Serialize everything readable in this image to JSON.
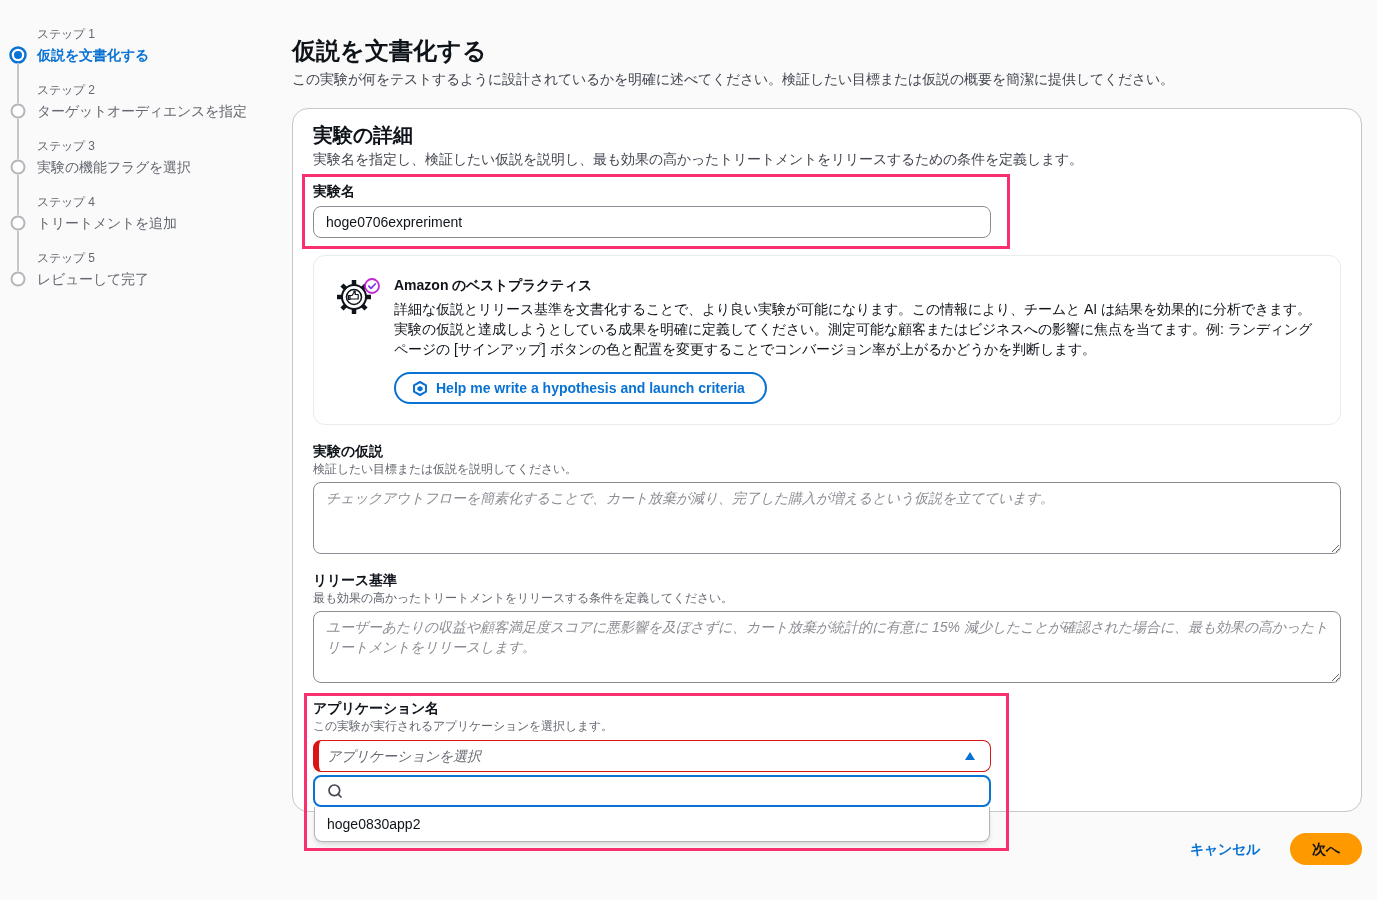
{
  "steps": [
    {
      "label": "ステップ 1",
      "title": "仮説を文書化する",
      "selected": true
    },
    {
      "label": "ステップ 2",
      "title": "ターゲットオーディエンスを指定",
      "selected": false
    },
    {
      "label": "ステップ 3",
      "title": "実験の機能フラグを選択",
      "selected": false
    },
    {
      "label": "ステップ 4",
      "title": "トリートメントを追加",
      "selected": false
    },
    {
      "label": "ステップ 5",
      "title": "レビューして完了",
      "selected": false
    }
  ],
  "page": {
    "title": "仮説を文書化する",
    "description": "この実験が何をテストするように設計されているかを明確に述べてください。検証したい目標または仮説の概要を簡潔に提供してください。"
  },
  "details": {
    "title": "実験の詳細",
    "description": "実験名を指定し、検証したい仮説を説明し、最も効果の高かったトリートメントをリリースするための条件を定義します。",
    "name_field": {
      "label": "実験名",
      "value": "hoge0706expreriment",
      "highlighted": true
    },
    "best_practices": {
      "title": "Amazon のベストプラクティス",
      "text": "詳細な仮説とリリース基準を文書化することで、より良い実験が可能になります。この情報により、チームと AI は結果を効果的に分析できます。実験の仮説と達成しようとしている成果を明確に定義してください。測定可能な顧客またはビジネスへの影響に焦点を当てます。例: ランディングページの [サインアップ] ボタンの色と配置を変更することでコンバージョン率が上がるかどうかを判断します。",
      "button": "Help me write a hypothesis and launch criteria"
    },
    "hypothesis": {
      "label": "実験の仮説",
      "description": "検証したい目標または仮説を説明してください。",
      "placeholder": "チェックアウトフローを簡素化することで、カート放棄が減り、完了した購入が増えるという仮説を立てています。"
    },
    "criteria": {
      "label": "リリース基準",
      "description": "最も効果の高かったトリートメントをリリースする条件を定義してください。",
      "placeholder": "ユーザーあたりの収益や顧客満足度スコアに悪影響を及ぼさずに、カート放棄が統計的に有意に 15% 減少したことが確認された場合に、最も効果の高かったトリートメントをリリースします。"
    },
    "application": {
      "label": "アプリケーション名",
      "description": "この実験が実行されるアプリケーションを選択します。",
      "placeholder": "アプリケーションを選択",
      "invalid": true,
      "expanded": true,
      "highlighted": true,
      "options": [
        {
          "label": "hoge0830app2"
        }
      ]
    }
  },
  "actions": {
    "cancel": "キャンセル",
    "next": "次へ"
  }
}
